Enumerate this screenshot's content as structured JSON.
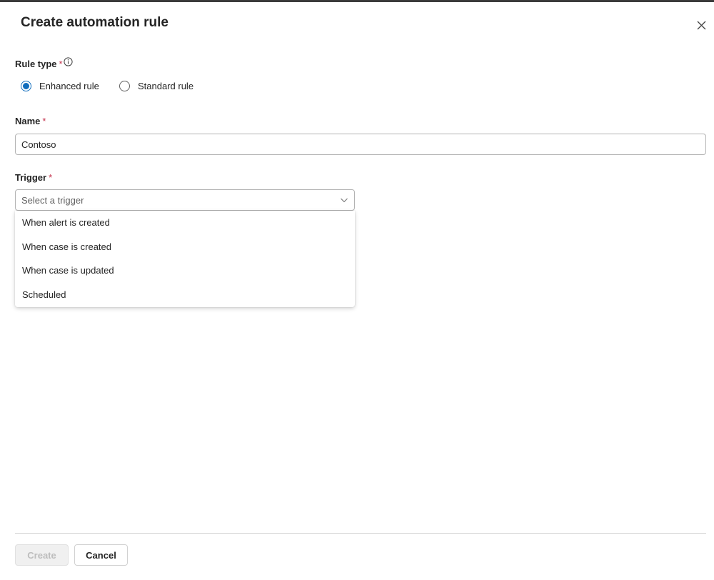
{
  "dialog": {
    "title": "Create automation rule"
  },
  "rule_type": {
    "label": "Rule type",
    "required_mark": "*",
    "options": [
      {
        "label": "Enhanced rule",
        "selected": true
      },
      {
        "label": "Standard rule",
        "selected": false
      }
    ]
  },
  "name": {
    "label": "Name",
    "required_mark": "*",
    "value": "Contoso"
  },
  "trigger": {
    "label": "Trigger",
    "required_mark": "*",
    "placeholder": "Select a trigger",
    "options": [
      "When alert is created",
      "When case is created",
      "When case is updated",
      "Scheduled"
    ]
  },
  "footer": {
    "create_label": "Create",
    "cancel_label": "Cancel"
  },
  "colors": {
    "accent": "#0f6cbd",
    "required": "#c4314b",
    "text": "#242424"
  }
}
